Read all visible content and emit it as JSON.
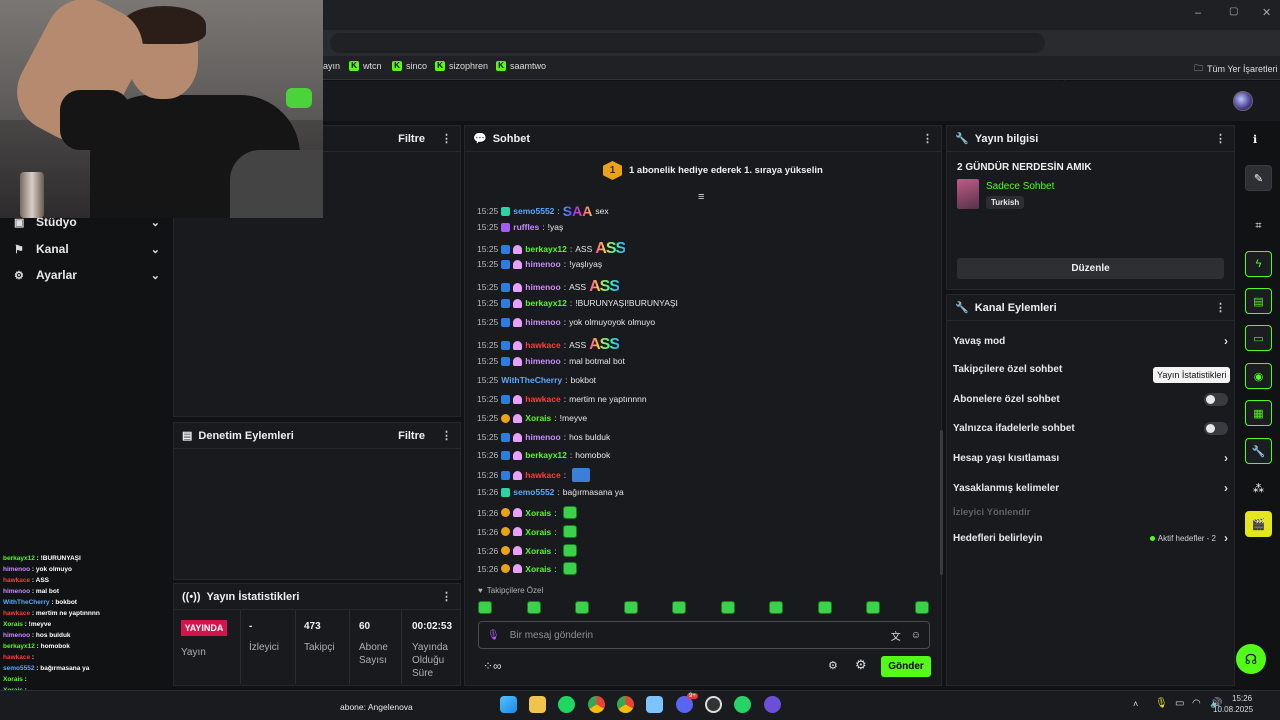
{
  "browser": {
    "bookmarks": [
      {
        "label": "ayın"
      },
      {
        "label": "wtcn"
      },
      {
        "label": "sinco"
      },
      {
        "label": "sizophren"
      },
      {
        "label": "saamtwo"
      }
    ],
    "all_bookmarks_label": "Tüm Yer İşaretleri"
  },
  "leftnav": {
    "items": [
      {
        "label": "Stüdyo"
      },
      {
        "label": "Kanal"
      },
      {
        "label": "Ayarlar"
      }
    ]
  },
  "panels": {
    "top_left_filter": "Filtre",
    "moderation_title": "Denetim Eylemleri",
    "moderation_filter": "Filtre",
    "stats_title": "Yayın İstatistikleri",
    "chat_title": "Sohbet",
    "info_title": "Yayın bilgisi",
    "actions_title": "Kanal Eylemleri"
  },
  "stats": {
    "live_badge": "YAYINDA",
    "live_label": "Yayın",
    "viewers_value": "-",
    "viewers_label": "İzleyici",
    "followers_value": "473",
    "followers_label": "Takipçi",
    "subs_value": "60",
    "subs_label": "Abone Sayısı",
    "uptime_value": "00:02:53",
    "uptime_label": "Yayında Olduğu Süre"
  },
  "chat": {
    "gift_banner": "1 abonelik hediye ederek 1. sıraya yükselin",
    "gift_rank": "1",
    "messages": [
      {
        "time": "15:25",
        "user": "semo5552",
        "text": "sex",
        "emote": "SAA"
      },
      {
        "time": "15:25",
        "user": "ruffles",
        "text": "!yaş",
        "emote": ""
      },
      {
        "time": "15:25",
        "user": "berkayx12",
        "text": "ASS",
        "emote": "ASS"
      },
      {
        "time": "15:25",
        "user": "himenoo",
        "text": "!yaşlıyaş",
        "emote": ""
      },
      {
        "time": "15:25",
        "user": "himenoo",
        "text": "ASS",
        "emote": "ASS"
      },
      {
        "time": "15:25",
        "user": "berkayx12",
        "text": "!BURUNYAŞI!BURUNYAŞI",
        "emote": ""
      },
      {
        "time": "15:25",
        "user": "himenoo",
        "text": "yok olmuyoyok olmuyo",
        "emote": ""
      },
      {
        "time": "15:25",
        "user": "hawkace",
        "text": "ASS",
        "emote": "ASS"
      },
      {
        "time": "15:25",
        "user": "himenoo",
        "text": "mal botmal bot",
        "emote": ""
      },
      {
        "time": "15:25",
        "user": "WithTheCherry",
        "text": "bokbot",
        "emote": ""
      },
      {
        "time": "15:25",
        "user": "hawkace",
        "text": "mertim ne yaptınnnn",
        "emote": ""
      },
      {
        "time": "15:25",
        "user": "Xorais",
        "text": "!meyve",
        "emote": ""
      },
      {
        "time": "15:25",
        "user": "himenoo",
        "text": "hos bulduk",
        "emote": ""
      },
      {
        "time": "15:26",
        "user": "berkayx12",
        "text": "homobok",
        "emote": ""
      },
      {
        "time": "15:26",
        "user": "hawkace",
        "text": "",
        "emote": "BL"
      },
      {
        "time": "15:26",
        "user": "semo5552",
        "text": "bağırmasana ya",
        "emote": ""
      },
      {
        "time": "15:26",
        "user": "Xorais",
        "text": "",
        "emote": "SQ"
      },
      {
        "time": "15:26",
        "user": "Xorais",
        "text": "",
        "emote": "SQ"
      },
      {
        "time": "15:26",
        "user": "Xorais",
        "text": "",
        "emote": "SQ"
      },
      {
        "time": "15:26",
        "user": "Xorais",
        "text": "",
        "emote": "SQ"
      }
    ],
    "followers_only_label": "Takipçilere Özel",
    "input_placeholder": "Bir mesaj gönderin",
    "send_label": "Gönder"
  },
  "info": {
    "stream_title": "2 GÜNDÜR NERDESİN AMIK",
    "category": "Sadece Sohbet",
    "language_tag": "Turkish",
    "edit_label": "Düzenle"
  },
  "actions": {
    "slow_mode": "Yavaş mod",
    "followers_only": "Takipçilere özel sohbet",
    "subs_only": "Abonelere özel sohbet",
    "emotes_only": "Yalnızca ifadelerle sohbet",
    "account_age": "Hesap yaşı kısıtlaması",
    "banned_words": "Yasaklanmış kelimeler",
    "raid_viewers": "İzleyici Yönlendir",
    "set_goals": "Hedefleri belirleyin",
    "active_goals": "Aktif hedefler - 2",
    "tooltip": "Yayın İstatistikleri"
  },
  "mini_chat": [
    {
      "user": "berkayx12",
      "text": "!BURUNYAŞI"
    },
    {
      "user": "himenoo",
      "text": "yok olmuyo"
    },
    {
      "user": "hawkace",
      "text": "ASS"
    },
    {
      "user": "himenoo",
      "text": "mal bot"
    },
    {
      "user": "WithTheCherry",
      "text": "bokbot"
    },
    {
      "user": "hawkace",
      "text": "mertim ne yaptınnnn"
    },
    {
      "user": "Xorais",
      "text": "!meyve"
    },
    {
      "user": "himenoo",
      "text": "hos bulduk"
    },
    {
      "user": "berkayx12",
      "text": "homobok"
    },
    {
      "user": "hawkace",
      "text": ""
    },
    {
      "user": "semo5552",
      "text": "bağırmasana ya"
    },
    {
      "user": "Xorais",
      "text": ""
    },
    {
      "user": "Xorais",
      "text": ""
    },
    {
      "user": "Xorais",
      "text": ""
    },
    {
      "user": "Xorais",
      "text": ""
    }
  ],
  "taskbar": {
    "now_playing": "abone: Angelenova",
    "time": "15:26",
    "date": "10.08.2025",
    "discord_badge": "9+"
  },
  "colors": {
    "accent": "#53fc18",
    "live_red": "#d4144a",
    "user_green": "#53fc18",
    "user_purple": "#c98bff",
    "user_red": "#ff3a3a",
    "user_blue": "#5aa9ff"
  }
}
